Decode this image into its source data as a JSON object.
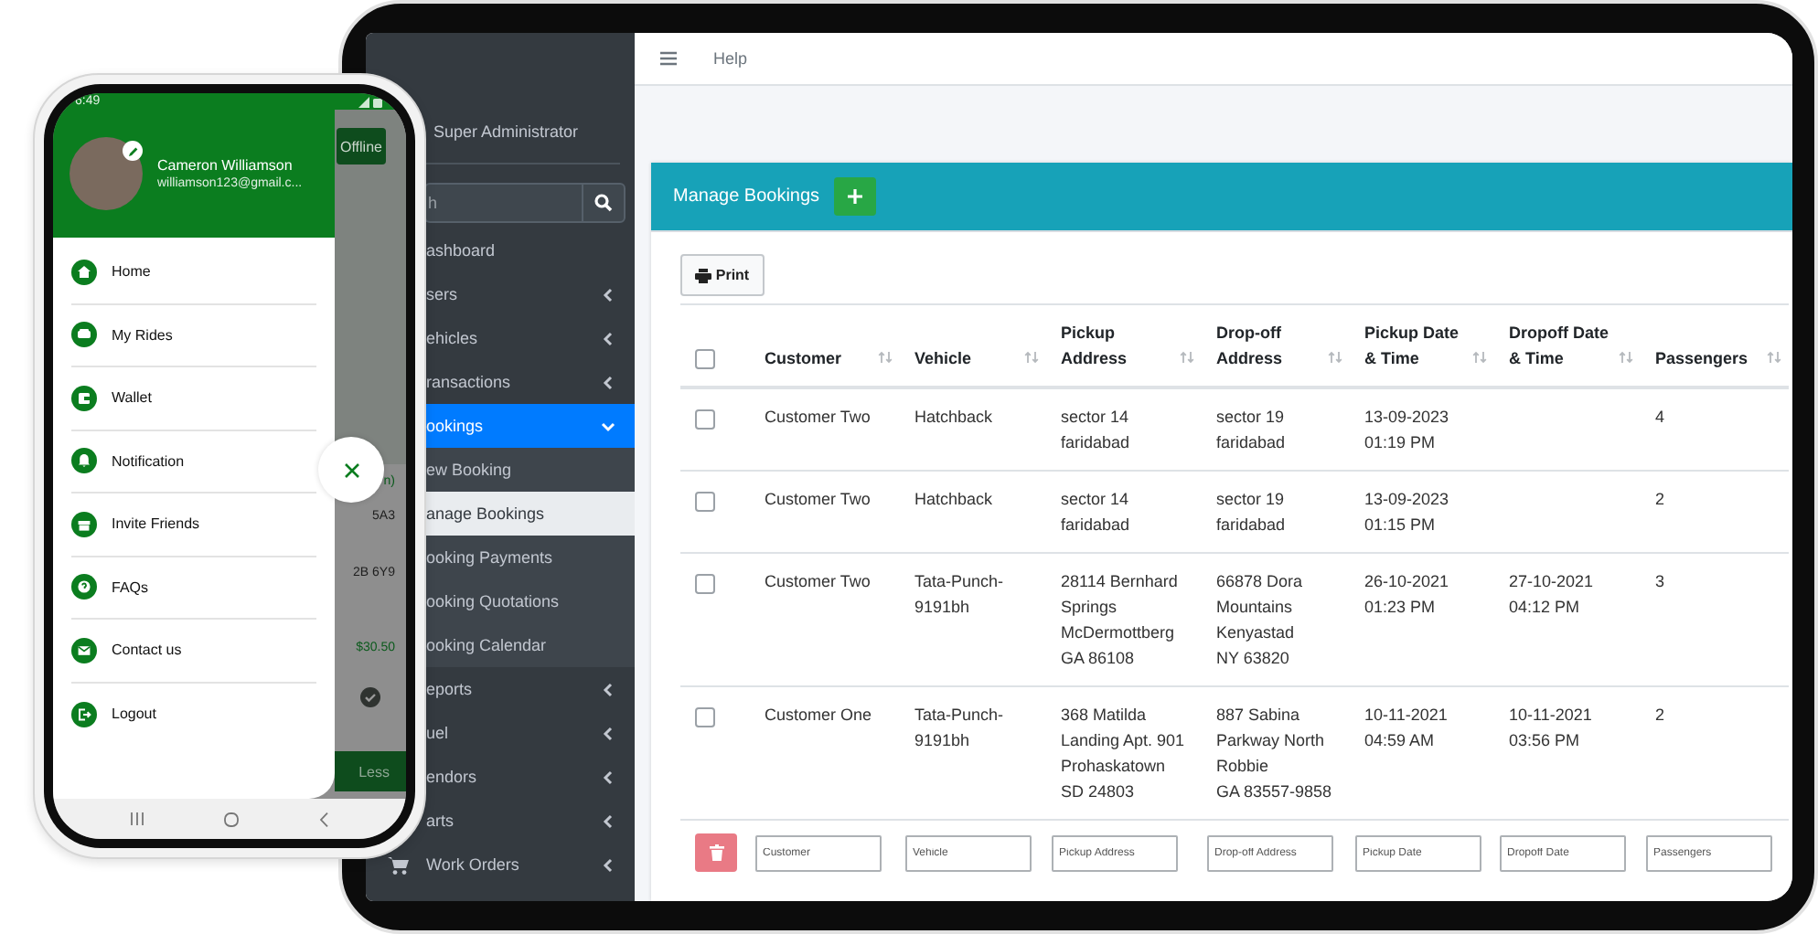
{
  "tablet": {
    "sidebar": {
      "user": "Super Administrator",
      "search": {
        "placeholder": "h"
      },
      "items": [
        {
          "label": "ashboard",
          "has_submenu": false,
          "selected": false
        },
        {
          "label": "sers",
          "has_submenu": true,
          "expanded": false,
          "selected": false
        },
        {
          "label": "ehicles",
          "has_submenu": true,
          "expanded": false,
          "selected": false
        },
        {
          "label": "ransactions",
          "has_submenu": true,
          "expanded": false,
          "selected": false
        },
        {
          "label": "ookings",
          "has_submenu": true,
          "expanded": true,
          "selected": true,
          "children": [
            {
              "label": "ew Booking",
              "selected": false
            },
            {
              "label": "anage Bookings",
              "selected": true
            },
            {
              "label": "ooking Payments",
              "selected": false
            },
            {
              "label": "ooking Quotations",
              "selected": false
            },
            {
              "label": "ooking Calendar",
              "selected": false
            }
          ]
        },
        {
          "label": "eports",
          "has_submenu": true,
          "expanded": false,
          "selected": false
        },
        {
          "label": "uel",
          "has_submenu": true,
          "expanded": false,
          "selected": false
        },
        {
          "label": "endors",
          "has_submenu": true,
          "expanded": false,
          "selected": false
        },
        {
          "label": "arts",
          "has_submenu": true,
          "expanded": false,
          "selected": false
        },
        {
          "label": "Work Orders",
          "has_submenu": true,
          "expanded": false,
          "selected": false,
          "kind": "cart"
        }
      ]
    },
    "navbar": {
      "help": "Help"
    },
    "card": {
      "title": "Manage Bookings",
      "print": "Print",
      "table": {
        "select_all": {
          "checked": false
        },
        "columns": [
          "Customer",
          "Vehicle",
          "Pickup\nAddress",
          "Drop-off\nAddress",
          "Pickup Date\n& Time",
          "Dropoff Date\n& Time",
          "Passengers"
        ],
        "rows": [
          {
            "checked": false,
            "cells": [
              "Customer Two",
              "Hatchback",
              "sector 14\nfaridabad",
              "sector 19\nfaridabad",
              "13-09-2023\n01:19 PM",
              null,
              "4"
            ]
          },
          {
            "checked": false,
            "cells": [
              "Customer Two",
              "Hatchback",
              "sector 14\nfaridabad",
              "sector 19\nfaridabad",
              "13-09-2023\n01:15 PM",
              null,
              "2"
            ]
          },
          {
            "checked": false,
            "cells": [
              "Customer Two",
              "Tata-Punch-\n9191bh",
              "28114 Bernhard\nSprings\nMcDermottberg\nGA 86108",
              "66878 Dora\nMountains\nKenyastad\nNY 63820",
              "26-10-2021\n01:23 PM",
              "27-10-2021\n04:12 PM",
              "3"
            ]
          },
          {
            "checked": false,
            "cells": [
              "Customer One",
              "Tata-Punch-\n9191bh",
              "368 Matilda\nLanding Apt. 901\nProhaskatown\nSD 24803",
              "887 Sabina\nParkway North\nRobbie\nGA 83557-9858",
              "10-11-2021\n04:59 AM",
              "10-11-2021\n03:56 PM",
              "2"
            ]
          }
        ],
        "filters": [
          {
            "placeholder": "Customer"
          },
          {
            "placeholder": "Vehicle"
          },
          {
            "placeholder": "Pickup Address"
          },
          {
            "placeholder": "Drop-off Address"
          },
          {
            "placeholder": "Pickup Date"
          },
          {
            "placeholder": "Dropoff Date"
          },
          {
            "placeholder": "Passengers"
          }
        ]
      }
    }
  },
  "phone": {
    "status_time": "6:49",
    "drawer": {
      "name": "Cameron Williamson",
      "email": "williamson123@gmail.c...",
      "items": [
        {
          "label": "Home",
          "kind": "home"
        },
        {
          "label": "My Rides",
          "kind": "car"
        },
        {
          "label": "Wallet",
          "kind": "wallet"
        },
        {
          "label": "Notification",
          "kind": "bell"
        },
        {
          "label": "Invite Friends",
          "kind": "gift"
        },
        {
          "label": "FAQs",
          "kind": "help"
        },
        {
          "label": "Contact us",
          "kind": "mail"
        },
        {
          "label": "Logout",
          "kind": "logout"
        }
      ]
    },
    "behind": {
      "offline": "Offline",
      "texts": [
        {
          "text": "n)",
          "kind": "accent"
        },
        {
          "text": "5A3",
          "kind": "plain"
        },
        {
          "text": "2B 6Y9",
          "kind": "plain"
        },
        {
          "text": "$30.50",
          "kind": "accent"
        }
      ],
      "less": "Less"
    }
  }
}
